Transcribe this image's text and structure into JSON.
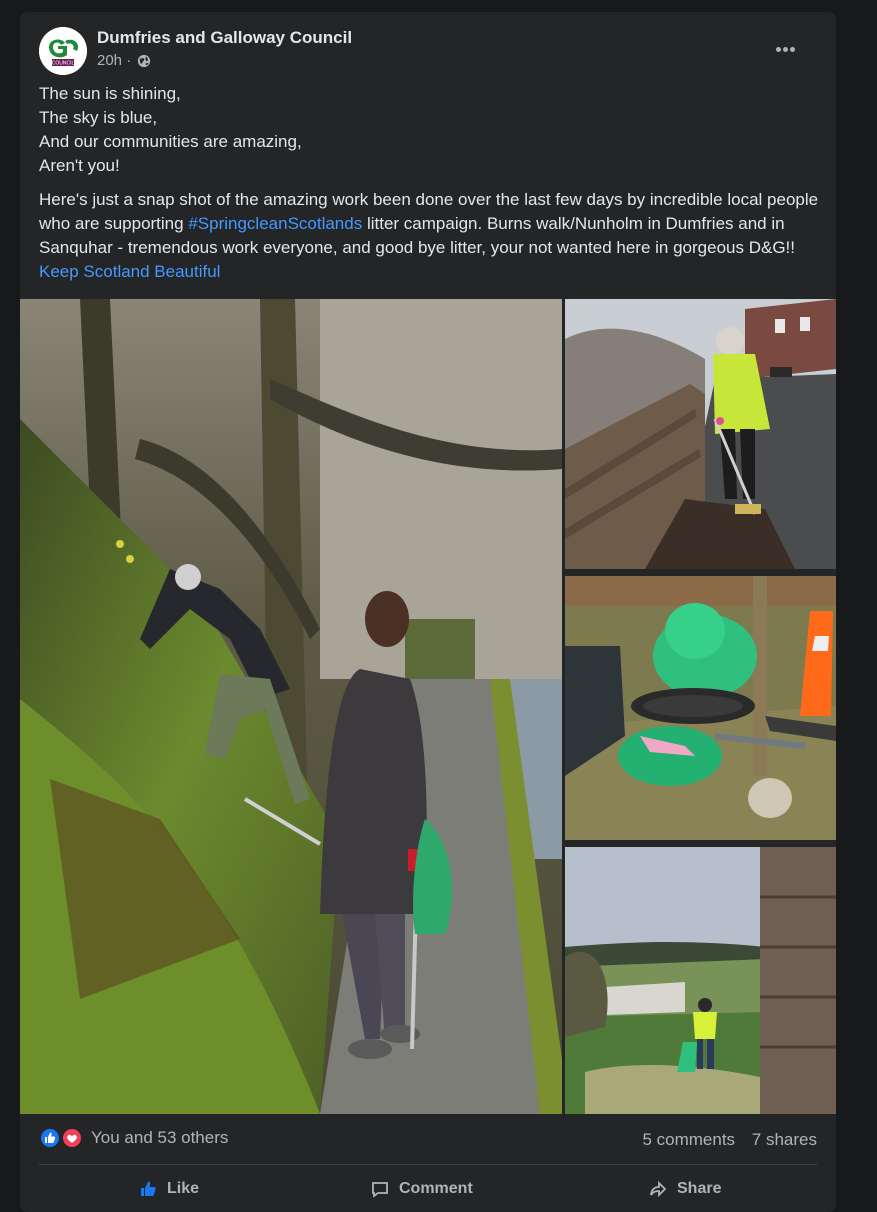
{
  "post": {
    "page_name": "Dumfries and Galloway Council",
    "time": "20h",
    "separator": "·",
    "avatar_logo_text": "DG",
    "avatar_badge_text": "COUNCIL",
    "poem_lines": [
      "The sun is shining,",
      "The sky is blue,",
      "And our communities are amazing,",
      "Aren't you!"
    ],
    "body_part1": "Here's just a snap shot of the amazing work been done over the last few days by incredible local people who are supporting ",
    "hashtag": "#SpringcleanScotlands",
    "body_part2": " litter campaign. Burns walk/Nunholm in Dumfries and in Sanquhar - tremendous work everyone, and good bye litter, your not wanted here in gorgeous D&G!!  ",
    "mention": "Keep Scotland Beautiful"
  },
  "photos": {
    "icons": [
      "main-photo",
      "photo-top-right",
      "photo-middle-right",
      "photo-bottom-right"
    ]
  },
  "stats": {
    "reactions_text": "You and 53 others",
    "comments": "5 comments",
    "shares": "7 shares",
    "reaction_icons": [
      "like-icon",
      "love-icon"
    ]
  },
  "actions": {
    "like": "Like",
    "comment": "Comment",
    "share": "Share"
  },
  "colors": {
    "background": "#18191a",
    "card": "#242526",
    "link": "#4599ff",
    "like_blue": "#1877f2",
    "love_red": "#f33e58"
  }
}
